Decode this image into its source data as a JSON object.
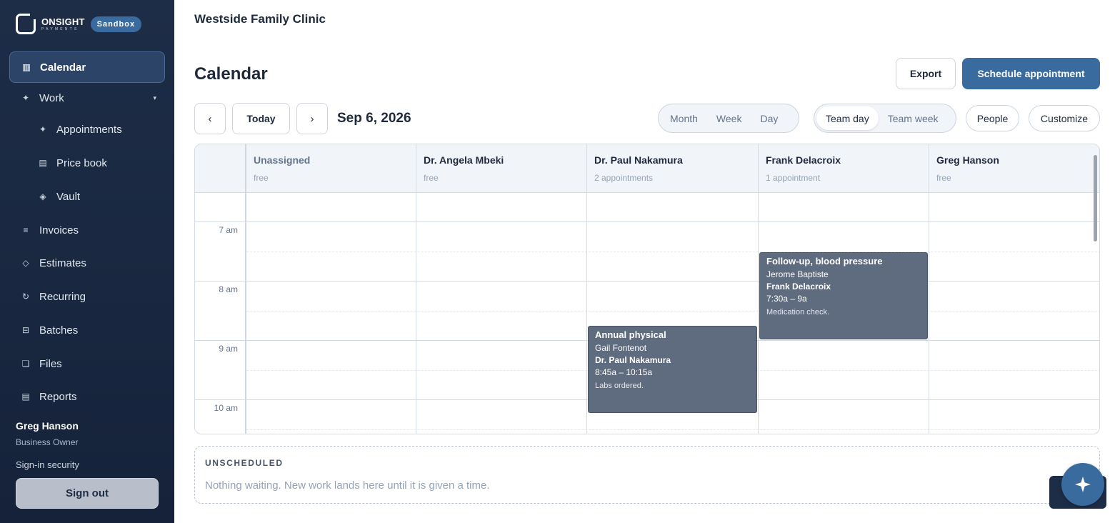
{
  "brand": {
    "name": "ONSIGHT",
    "tagline": "PAYMENTS",
    "badge": "Sandbox"
  },
  "nav": {
    "calendar": "Calendar",
    "work": "Work",
    "appointments": "Appointments",
    "price_book": "Price book",
    "vault": "Vault",
    "invoices": "Invoices",
    "estimates": "Estimates",
    "recurring": "Recurring",
    "batches": "Batches",
    "files": "Files",
    "reports": "Reports"
  },
  "user": {
    "name": "Greg Hanson",
    "role": "Business Owner",
    "security": "Sign-in security",
    "sign_out": "Sign out"
  },
  "header": {
    "clinic": "Westside Family Clinic",
    "title": "Calendar",
    "export": "Export",
    "schedule": "Schedule appointment"
  },
  "toolbar": {
    "prev": "‹",
    "today": "Today",
    "next": "›",
    "date": "Sep 6, 2026",
    "views": [
      "Month",
      "Week",
      "Day"
    ],
    "team_views": [
      "Team day",
      "Team week"
    ],
    "active_team_view": "Team day",
    "people": "People",
    "customize": "Customize"
  },
  "columns": [
    {
      "name": "Unassigned",
      "summary": "free"
    },
    {
      "name": "Dr. Angela Mbeki",
      "summary": "free"
    },
    {
      "name": "Dr. Paul Nakamura",
      "summary": "2 appointments"
    },
    {
      "name": "Frank Delacroix",
      "summary": "1 appointment"
    },
    {
      "name": "Greg Hanson",
      "summary": "free"
    }
  ],
  "hours": [
    "7 am",
    "8 am",
    "9 am",
    "10 am"
  ],
  "events": [
    {
      "title": "Follow-up, blood pressure",
      "patient": "Jerome Baptiste",
      "provider": "Frank Delacroix",
      "time": "7:30a – 9a",
      "note": "Medication check."
    },
    {
      "title": "Annual physical",
      "patient": "Gail Fontenot",
      "provider": "Dr. Paul Nakamura",
      "time": "8:45a – 10:15a",
      "note": "Labs ordered."
    }
  ],
  "unscheduled": {
    "label": "UNSCHEDULED",
    "message": "Nothing waiting. New work lands here until it is given a time."
  },
  "colors": {
    "sidebar": "#1e2d47",
    "accent": "#3a6b9e",
    "event": "#5f6b7e"
  }
}
